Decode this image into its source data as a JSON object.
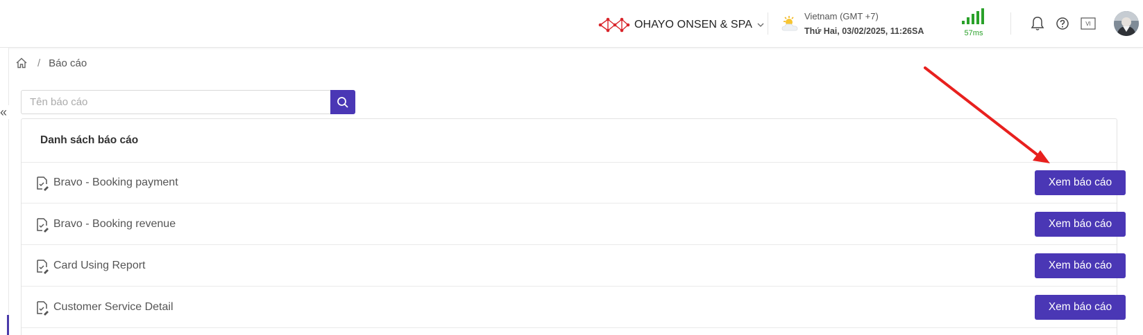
{
  "header": {
    "brand_name": "OHAYO ONSEN & SPA",
    "timezone": "Vietnam (GMT +7)",
    "datetime": "Thứ Hai, 03/02/2025, 11:26SA",
    "latency": "57ms",
    "language_code": "VI",
    "signal_color": "#2aa12a",
    "logo_color": "#d9252b"
  },
  "breadcrumb": {
    "current": "Báo cáo",
    "separator": "/"
  },
  "search": {
    "placeholder": "Tên báo cáo",
    "value": ""
  },
  "reports": {
    "title": "Danh sách báo cáo",
    "view_label": "Xem báo cáo",
    "items": [
      {
        "name": "Bravo - Booking payment"
      },
      {
        "name": "Bravo - Booking revenue"
      },
      {
        "name": "Card Using Report"
      },
      {
        "name": "Customer Service Detail"
      }
    ]
  },
  "colors": {
    "accent": "#4a37b5",
    "annotation_arrow": "#e8201e"
  }
}
